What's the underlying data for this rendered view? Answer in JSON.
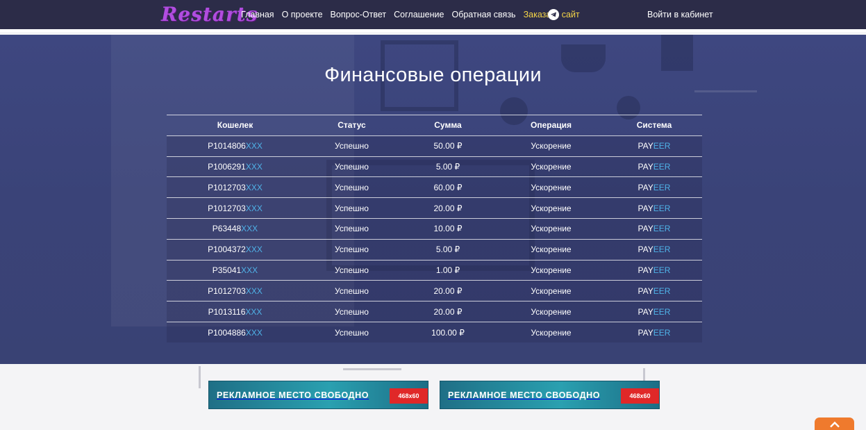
{
  "header": {
    "logo": "Restarts",
    "nav": [
      {
        "label": "Главная"
      },
      {
        "label": "О проекте"
      },
      {
        "label": "Вопрос-Ответ"
      },
      {
        "label": "Соглашение"
      },
      {
        "label": "Обратная связь"
      },
      {
        "label": "Заказать сайт"
      }
    ],
    "telegram_icon": "telegram-icon",
    "login": "Войти в кабинет",
    "highlight_color": "#f5d547"
  },
  "page": {
    "title": "Финансовые операции"
  },
  "table": {
    "columns": [
      "Кошелек",
      "Статус",
      "Сумма",
      "Операция",
      "Система"
    ],
    "rows": [
      {
        "wallet": "P1014806",
        "mask": "XXX",
        "status": "Успешно",
        "amount": "50.00 ₽",
        "operation": "Ускорение",
        "sys_a": "PAY",
        "sys_b": "EER"
      },
      {
        "wallet": "P1006291",
        "mask": "XXX",
        "status": "Успешно",
        "amount": "5.00 ₽",
        "operation": "Ускорение",
        "sys_a": "PAY",
        "sys_b": "EER"
      },
      {
        "wallet": "P1012703",
        "mask": "XXX",
        "status": "Успешно",
        "amount": "60.00 ₽",
        "operation": "Ускорение",
        "sys_a": "PAY",
        "sys_b": "EER"
      },
      {
        "wallet": "P1012703",
        "mask": "XXX",
        "status": "Успешно",
        "amount": "20.00 ₽",
        "operation": "Ускорение",
        "sys_a": "PAY",
        "sys_b": "EER"
      },
      {
        "wallet": "P63448",
        "mask": "XXX",
        "status": "Успешно",
        "amount": "10.00 ₽",
        "operation": "Ускорение",
        "sys_a": "PAY",
        "sys_b": "EER"
      },
      {
        "wallet": "P1004372",
        "mask": "XXX",
        "status": "Успешно",
        "amount": "5.00 ₽",
        "operation": "Ускорение",
        "sys_a": "PAY",
        "sys_b": "EER"
      },
      {
        "wallet": "P35041",
        "mask": "XXX",
        "status": "Успешно",
        "amount": "1.00 ₽",
        "operation": "Ускорение",
        "sys_a": "PAY",
        "sys_b": "EER"
      },
      {
        "wallet": "P1012703",
        "mask": "XXX",
        "status": "Успешно",
        "amount": "20.00 ₽",
        "operation": "Ускорение",
        "sys_a": "PAY",
        "sys_b": "EER"
      },
      {
        "wallet": "P1013116",
        "mask": "XXX",
        "status": "Успешно",
        "amount": "20.00 ₽",
        "operation": "Ускорение",
        "sys_a": "PAY",
        "sys_b": "EER"
      },
      {
        "wallet": "P1004886",
        "mask": "XXX",
        "status": "Успешно",
        "amount": "100.00 ₽",
        "operation": "Ускорение",
        "sys_a": "PAY",
        "sys_b": "EER"
      }
    ],
    "accent_color": "#4fb3e8"
  },
  "banners": [
    {
      "text": "РЕКЛАМНОЕ  МЕСТО СВОБОДНО",
      "size": "468x60"
    },
    {
      "text": "РЕКЛАМНОЕ  МЕСТО СВОБОДНО",
      "size": "468x60"
    }
  ],
  "scroll_top_icon": "chevron-up-icon"
}
